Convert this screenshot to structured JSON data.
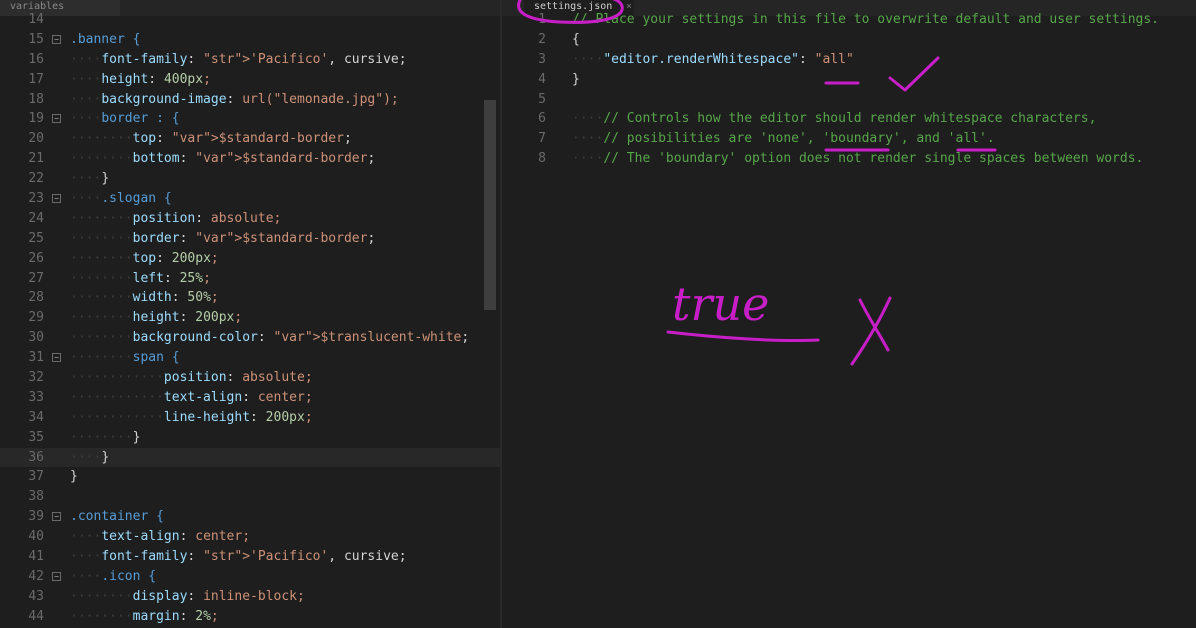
{
  "left_editor": {
    "tab_label": "variables",
    "lines": [
      {
        "n": "14",
        "ws": "",
        "fold": "",
        "text": ""
      },
      {
        "n": "15",
        "ws": "",
        "fold": "−",
        "text": ".banner {"
      },
      {
        "n": "16",
        "ws": "····",
        "fold": "",
        "text": "font-family: 'Pacifico', cursive;"
      },
      {
        "n": "17",
        "ws": "····",
        "fold": "",
        "text": "height: 400px;"
      },
      {
        "n": "18",
        "ws": "····",
        "fold": "",
        "text": "background-image: url(\"lemonade.jpg\");"
      },
      {
        "n": "19",
        "ws": "····",
        "fold": "−",
        "text": "border : {"
      },
      {
        "n": "20",
        "ws": "········",
        "fold": "",
        "text": "top: $standard-border;"
      },
      {
        "n": "21",
        "ws": "········",
        "fold": "",
        "text": "bottom: $standard-border;"
      },
      {
        "n": "22",
        "ws": "····",
        "fold": "",
        "text": "}"
      },
      {
        "n": "23",
        "ws": "····",
        "fold": "−",
        "text": ".slogan {"
      },
      {
        "n": "24",
        "ws": "········",
        "fold": "",
        "text": "position: absolute;"
      },
      {
        "n": "25",
        "ws": "········",
        "fold": "",
        "text": "border: $standard-border;"
      },
      {
        "n": "26",
        "ws": "········",
        "fold": "",
        "text": "top: 200px;"
      },
      {
        "n": "27",
        "ws": "········",
        "fold": "",
        "text": "left: 25%;"
      },
      {
        "n": "28",
        "ws": "········",
        "fold": "",
        "text": "width: 50%;"
      },
      {
        "n": "29",
        "ws": "········",
        "fold": "",
        "text": "height: 200px;"
      },
      {
        "n": "30",
        "ws": "········",
        "fold": "",
        "text": "background-color: $translucent-white;"
      },
      {
        "n": "31",
        "ws": "········",
        "fold": "−",
        "text": "span {"
      },
      {
        "n": "32",
        "ws": "············",
        "fold": "",
        "text": "position: absolute;"
      },
      {
        "n": "33",
        "ws": "············",
        "fold": "",
        "text": "text-align: center;"
      },
      {
        "n": "34",
        "ws": "············",
        "fold": "",
        "text": "line-height: 200px;"
      },
      {
        "n": "35",
        "ws": "········",
        "fold": "",
        "text": "}"
      },
      {
        "n": "36",
        "ws": "····",
        "fold": "",
        "text": "}"
      },
      {
        "n": "37",
        "ws": "",
        "fold": "",
        "text": "}"
      },
      {
        "n": "38",
        "ws": "",
        "fold": "",
        "text": ""
      },
      {
        "n": "39",
        "ws": "",
        "fold": "−",
        "text": ".container {"
      },
      {
        "n": "40",
        "ws": "····",
        "fold": "",
        "text": "text-align: center;"
      },
      {
        "n": "41",
        "ws": "····",
        "fold": "",
        "text": "font-family: 'Pacifico', cursive;"
      },
      {
        "n": "42",
        "ws": "····",
        "fold": "−",
        "text": ".icon {"
      },
      {
        "n": "43",
        "ws": "········",
        "fold": "",
        "text": "display: inline-block;"
      },
      {
        "n": "44",
        "ws": "········",
        "fold": "",
        "text": "margin: 2%;"
      }
    ]
  },
  "right_editor": {
    "tab_label": "settings.json",
    "lines": [
      {
        "n": "1",
        "ws": "",
        "text": "// Place your settings in this file to overwrite default and user settings."
      },
      {
        "n": "2",
        "ws": "",
        "text": "{"
      },
      {
        "n": "3",
        "ws": "····",
        "text": "\"editor.renderWhitespace\": \"all\""
      },
      {
        "n": "4",
        "ws": "",
        "text": "}"
      },
      {
        "n": "5",
        "ws": "",
        "text": ""
      },
      {
        "n": "6",
        "ws": "····",
        "text": "// Controls how the editor should render whitespace characters,"
      },
      {
        "n": "7",
        "ws": "····",
        "text": "// posibilities are 'none', 'boundary', and 'all'."
      },
      {
        "n": "8",
        "ws": "····",
        "text": "// The 'boundary' option does not render single spaces between words."
      }
    ]
  },
  "annotation": {
    "text": "true",
    "ink_color": "#c81ec8"
  },
  "colors": {
    "background": "#1e1e1e",
    "line_number": "#6a6a6a",
    "comment": "#57a64a",
    "property": "#9cdcfe",
    "string": "#ce9178"
  }
}
